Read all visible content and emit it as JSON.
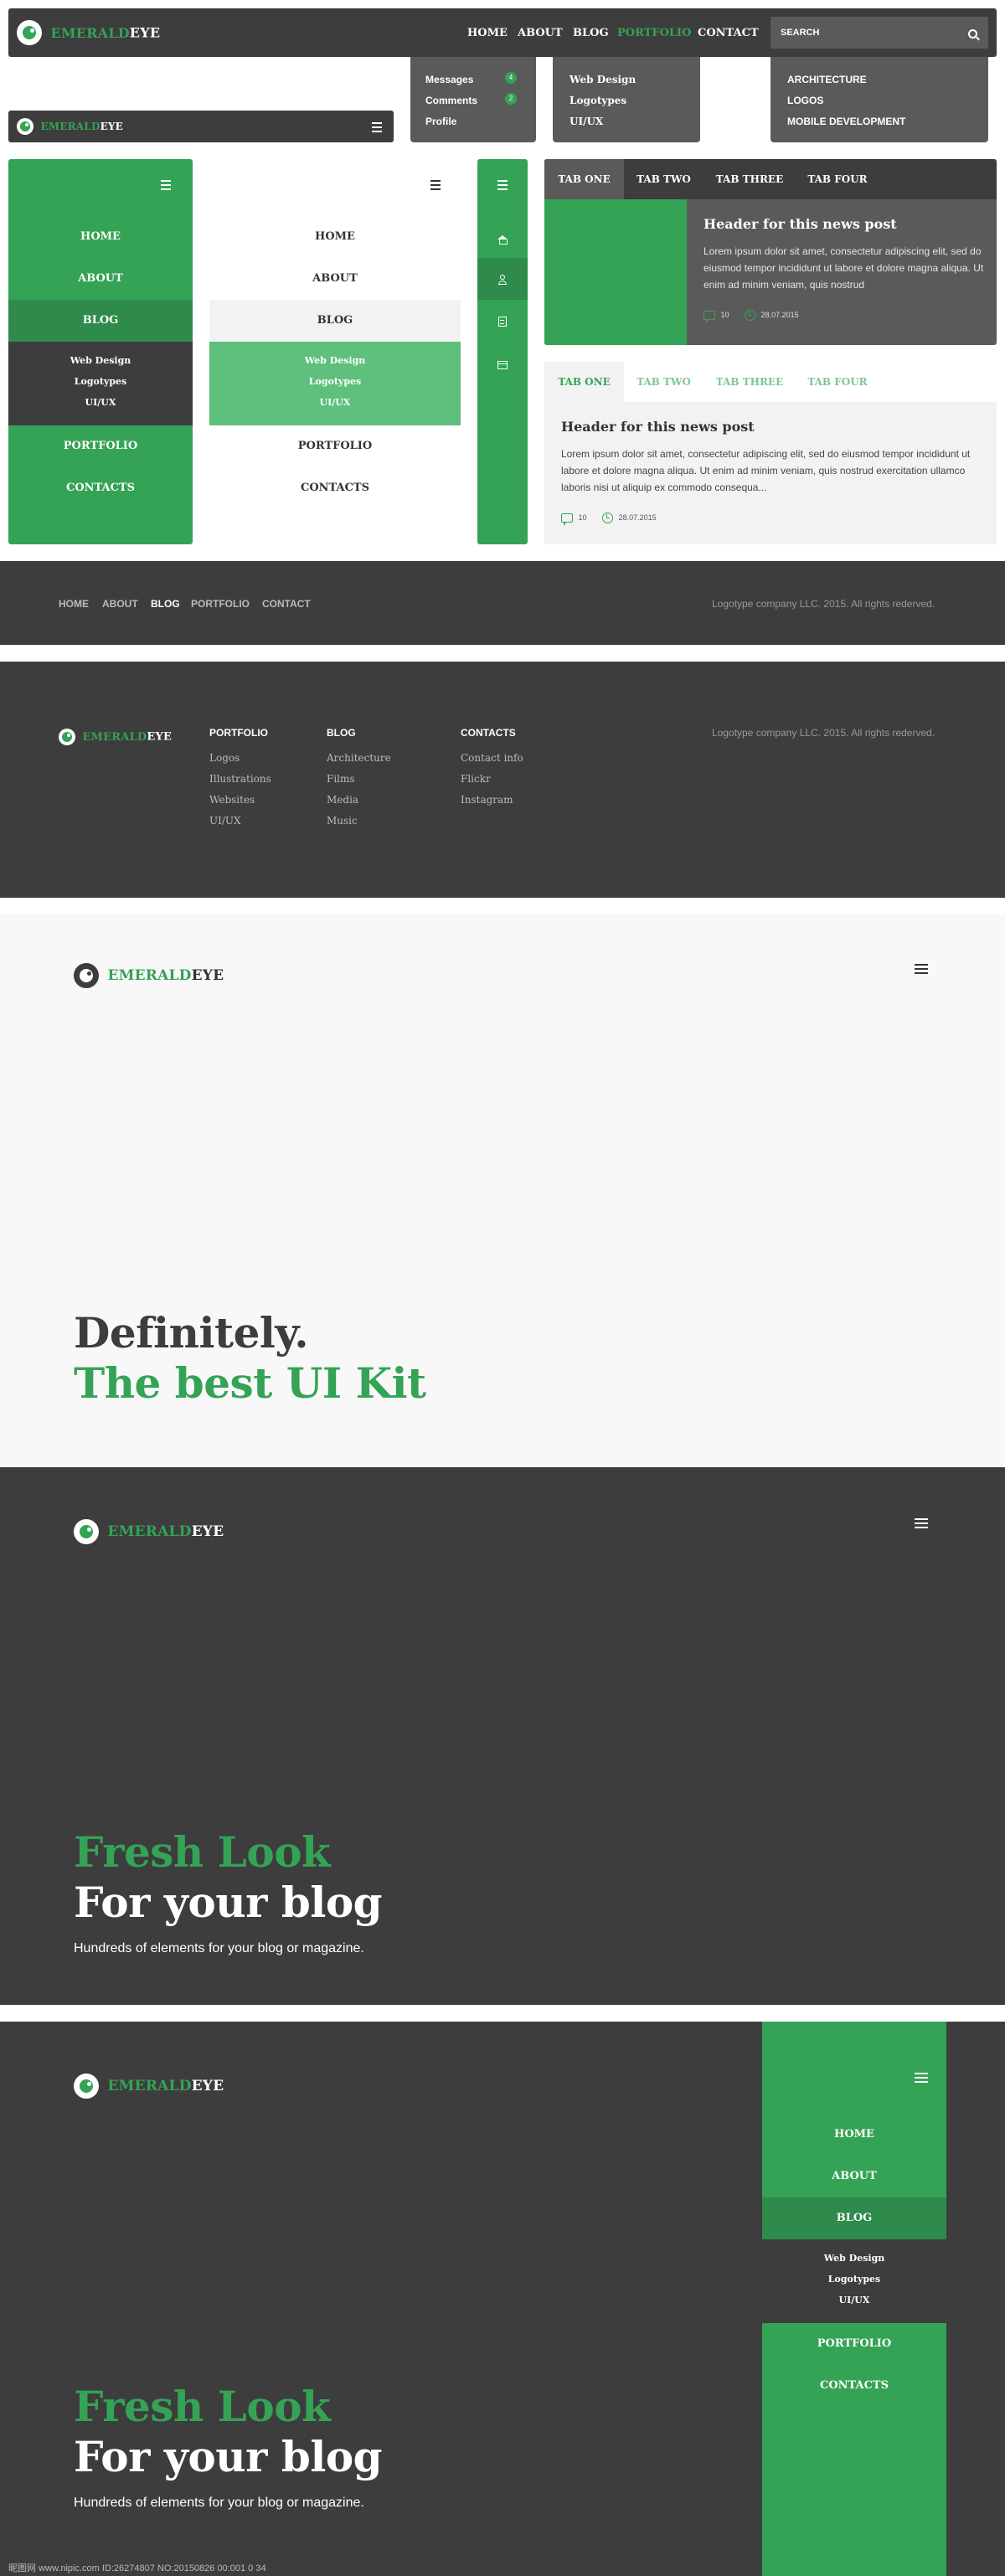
{
  "brand": {
    "name_green": "EMERALD",
    "name_rest": "EYE"
  },
  "colors": {
    "accent": "#34a355",
    "dark": "#3d3d3d",
    "mid": "#5a5a5a",
    "light": "#f4f4f4"
  },
  "topnav": {
    "items": [
      "HOME",
      "ABOUT",
      "BLOG",
      "PORTFOLIO",
      "CONTACT"
    ],
    "active": "PORTFOLIO",
    "search_placeholder": "SEARCH"
  },
  "dropdown_user": {
    "items": [
      {
        "label": "Messages",
        "badge": "4"
      },
      {
        "label": "Comments",
        "badge": "2"
      },
      {
        "label": "Profile",
        "badge": ""
      }
    ]
  },
  "dropdown_portfolio": {
    "items": [
      "Web Design",
      "Logotypes",
      "UI/UX"
    ]
  },
  "dropdown_search": {
    "items": [
      "ARCHITECTURE",
      "LOGOS",
      "MOBILE DEVELOPMENT"
    ]
  },
  "side_menu": {
    "items": [
      "HOME",
      "ABOUT",
      "BLOG",
      "PORTFOLIO",
      "CONTACTS"
    ],
    "active": "BLOG",
    "sub_items": [
      "Web Design",
      "Logotypes",
      "UI/UX"
    ]
  },
  "icon_menu": {
    "icons": [
      "home-icon",
      "user-icon",
      "document-icon",
      "card-icon"
    ]
  },
  "tabs_dark": {
    "tabs": [
      "TAB ONE",
      "TAB TWO",
      "TAB THREE",
      "TAB FOUR"
    ],
    "post": {
      "title": "Header for this news post",
      "body": "Lorem ipsum dolor sit amet, consectetur adipiscing elit, sed do eiusmod tempor incididunt ut labore et dolore magna aliqua. Ut enim ad minim veniam, quis nostrud",
      "comments": "10",
      "date": "28.07.2015"
    }
  },
  "tabs_light": {
    "tabs": [
      "TAB ONE",
      "TAB TWO",
      "TAB THREE",
      "TAB FOUR"
    ],
    "post": {
      "title": "Header for this news post",
      "body": "Lorem ipsum dolor sit amet, consectetur adipiscing elit, sed do eiusmod tempor incididunt ut labore et dolore magna aliqua. Ut enim ad minim veniam, quis nostrud exercitation ullamco laboris nisi ut aliquip ex commodo consequa...",
      "comments": "10",
      "date": "28.07.2015"
    }
  },
  "footer_simple": {
    "links": [
      "HOME",
      "ABOUT",
      "BLOG",
      "PORTFOLIO",
      "CONTACT"
    ],
    "active": "BLOG",
    "copyright": "Logotype company LLC. 2015. All rights rederved."
  },
  "footer_full": {
    "columns": [
      {
        "title": "PORTFOLIO",
        "items": [
          "Logos",
          "Illustrations",
          "Websites",
          "UI/UX"
        ]
      },
      {
        "title": "BLOG",
        "items": [
          "Architecture",
          "Films",
          "Media",
          "Music"
        ]
      },
      {
        "title": "CONTACTS",
        "items": [
          "Contact info",
          "Flickr",
          "Instagram"
        ]
      }
    ],
    "copyright": "Logotype company LLC. 2015. All rights rederved."
  },
  "hero_light": {
    "line1": "Definitely.",
    "line2": "The best UI Kit"
  },
  "hero_dark": {
    "line1": "Fresh Look",
    "line2": "For your blog",
    "tagline": "Hundreds of elements for your blog or magazine."
  },
  "hero_menu": {
    "line1": "Fresh Look",
    "line2": "For your blog",
    "tagline": "Hundreds of elements for your blog or magazine.",
    "items": [
      "HOME",
      "ABOUT",
      "BLOG",
      "PORTFOLIO",
      "CONTACTS"
    ],
    "sub_items": [
      "Web Design",
      "Logotypes",
      "UI/UX"
    ]
  },
  "watermark": "昵图网 www.nipic.com  ID:26274807 NO:20150826 00:001 0 34"
}
